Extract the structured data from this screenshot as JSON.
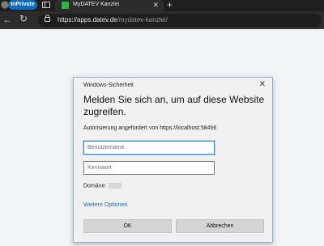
{
  "browser": {
    "inprivate_label": "InPrivate",
    "tab": {
      "title": "MyDATEV Kanzlei",
      "close": "✕"
    },
    "new_tab": "+",
    "back": "←",
    "reload": "↻",
    "url": {
      "host": "https://apps.datev.de",
      "path": "/mydatev-kanzlei/"
    }
  },
  "dialog": {
    "title": "Windows-Sicherheit",
    "close": "✕",
    "heading": "Melden Sie sich an, um auf diese Website zugreifen.",
    "message": "Autorisierung angefordert von https://localhost:58456",
    "username_placeholder": "Benutzername",
    "password_placeholder": "Kennwort",
    "domain_label": "Domäne:",
    "more_options": "Weitere Optionen",
    "ok": "OK",
    "cancel": "Abbrechen"
  },
  "colors": {
    "accent": "#0f6cbd",
    "link": "#1f6fb5",
    "favicon": "#2fb34a"
  }
}
